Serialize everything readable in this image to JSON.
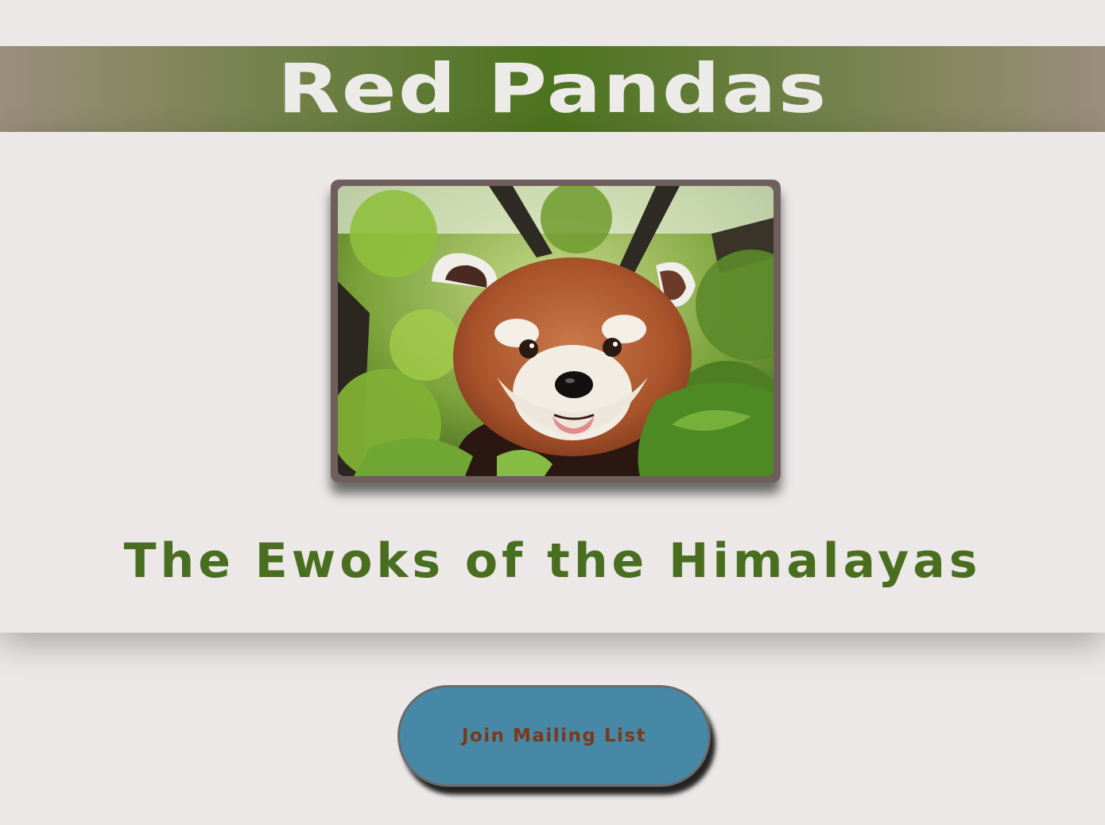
{
  "header": {
    "title": "Red Pandas"
  },
  "hero": {
    "image_subject": "red-panda-photo",
    "tagline": "The Ewoks of the Himalayas"
  },
  "cta": {
    "label": "Join Mailing List"
  },
  "colors": {
    "background": "#ebe8e7",
    "banner_center": "#4c741f",
    "banner_edge": "#9b8e7c",
    "title_text": "#ecebe8",
    "tagline_text": "#4a6e1f",
    "frame": "#6f5f5c",
    "button_bg": "#4788a6",
    "button_text": "#7a3a1a"
  }
}
